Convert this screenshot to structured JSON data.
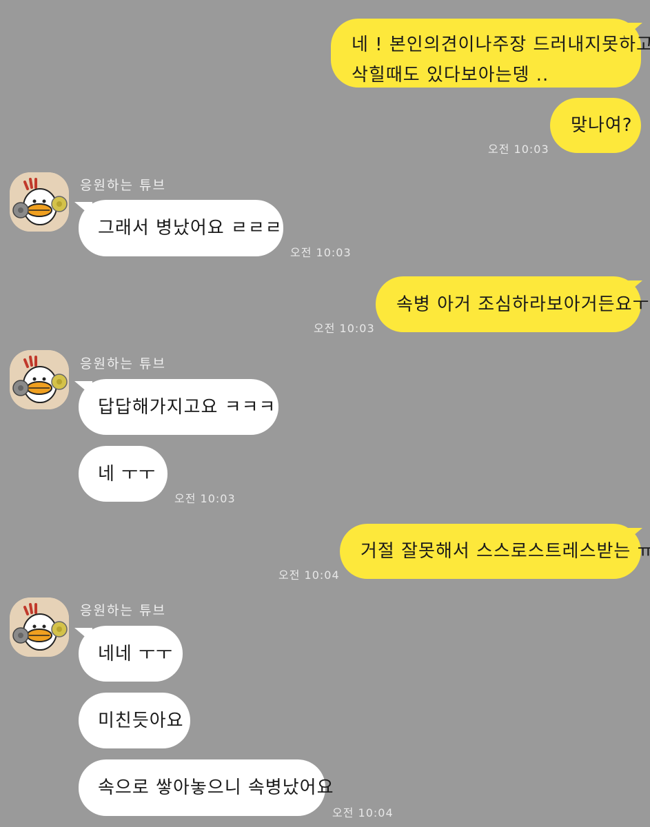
{
  "chat": {
    "messages": [
      {
        "side": "out",
        "lines": [
          "네 ! 본인의견이나주장 드러내지못하고",
          "삭힐때도 있다보아는뎅 .."
        ]
      },
      {
        "side": "out",
        "lines": [
          "맞나여?"
        ],
        "time": "오전 10:03"
      },
      {
        "side": "in",
        "sender": "응원하는 튜브",
        "lines": [
          "그래서 병났어요 ㄹㄹㄹ"
        ],
        "time": "오전 10:03"
      },
      {
        "side": "out",
        "lines": [
          "속병 아거 조심하라보아거든요ㅜ"
        ],
        "time": "오전 10:03"
      },
      {
        "side": "in",
        "sender": "응원하는 튜브",
        "lines": [
          "답답해가지고요 ㅋㅋㅋ"
        ]
      },
      {
        "side": "in",
        "lines": [
          "네 ㅜㅜ"
        ],
        "time": "오전 10:03"
      },
      {
        "side": "out",
        "lines": [
          "거절 잘못해서 스스로스트레스받는 ㅠ"
        ],
        "time": "오전 10:04"
      },
      {
        "side": "in",
        "sender": "응원하는 튜브",
        "lines": [
          "네네 ㅜㅜ"
        ]
      },
      {
        "side": "in",
        "lines": [
          "미친듯아요"
        ]
      },
      {
        "side": "in",
        "lines": [
          "속으로 쌓아놓으니 속병났어요"
        ],
        "time": "오전 10:04"
      }
    ]
  },
  "colors": {
    "background": "#9a9a9a",
    "outgoing_bubble": "#fde83b",
    "incoming_bubble": "#ffffff",
    "timestamp": "#e8e8e8",
    "avatar_bg": "#e6d2b7"
  },
  "icons": {
    "avatar": "tube-cheering-character-icon"
  }
}
